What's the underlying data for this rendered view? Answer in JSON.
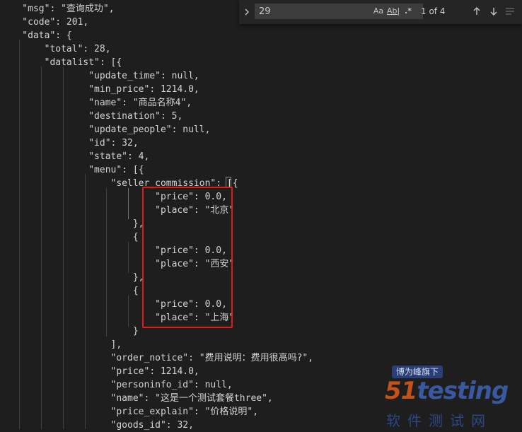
{
  "code_lines": [
    {
      "text": "    \"msg\": \"查询成功\","
    },
    {
      "text": "    \"code\": 201,"
    },
    {
      "text": "    \"data\": {"
    },
    {
      "text": "        \"total\": 28,"
    },
    {
      "text": "        \"datalist\": [{"
    },
    {
      "text": "                \"update_time\": null,"
    },
    {
      "text": "                \"min_price\": 1214.0,"
    },
    {
      "text": "                \"name\": \"商品名称4\","
    },
    {
      "text": "                \"destination\": 5,"
    },
    {
      "text": "                \"update_people\": null,"
    },
    {
      "text": "                \"id\": 32,"
    },
    {
      "text": "                \"state\": 4,"
    },
    {
      "text": "                \"menu\": [{"
    },
    {
      "text": "                    \"seller_commission\": [{"
    },
    {
      "text": "                            \"price\": 0.0,"
    },
    {
      "text": "                            \"place\": \"北京\""
    },
    {
      "text": "                        },"
    },
    {
      "text": "                        {"
    },
    {
      "text": ""
    },
    {
      "text": "                            \"price\": 0.0,"
    },
    {
      "text": "                            \"place\": \"西安\""
    },
    {
      "text": "                        },"
    },
    {
      "text": "                        {"
    },
    {
      "text": ""
    },
    {
      "text": "                            \"price\": 0.0,"
    },
    {
      "text": "                            \"place\": \"上海\""
    },
    {
      "text": "                        }"
    },
    {
      "text": "                    ],"
    },
    {
      "text": "                    \"order_notice\": \"费用说明：费用很高吗?\","
    },
    {
      "text": "                    \"price\": 1214.0,"
    },
    {
      "text": "                    \"personinfo_id\": null,"
    },
    {
      "text": "                    \"name\": \"这是一个测试套餐three\","
    },
    {
      "text": "                    \"price_explain\": \"价格说明\","
    },
    {
      "text": "                    \"goods_id\": 32,"
    }
  ],
  "find_widget": {
    "toggle_icon": "chevron-right-icon",
    "query": "29",
    "match_case_label": "Aa",
    "whole_word_label": "Ab|",
    "regex_label": ".*",
    "result_count": "1 of 4",
    "prev_icon": "arrow-up-icon",
    "next_icon": "arrow-down-icon",
    "selection_icon": "find-in-selection-icon"
  },
  "watermark": {
    "tagline": "博为峰旗下",
    "logo_prefix": "51",
    "logo_suffix": "testing",
    "subtitle": "软件测试网"
  },
  "colors": {
    "background": "#1e1e1e",
    "text": "#d4d4d4",
    "highlight_box": "#e01b1b",
    "find_widget_bg": "#252526"
  }
}
